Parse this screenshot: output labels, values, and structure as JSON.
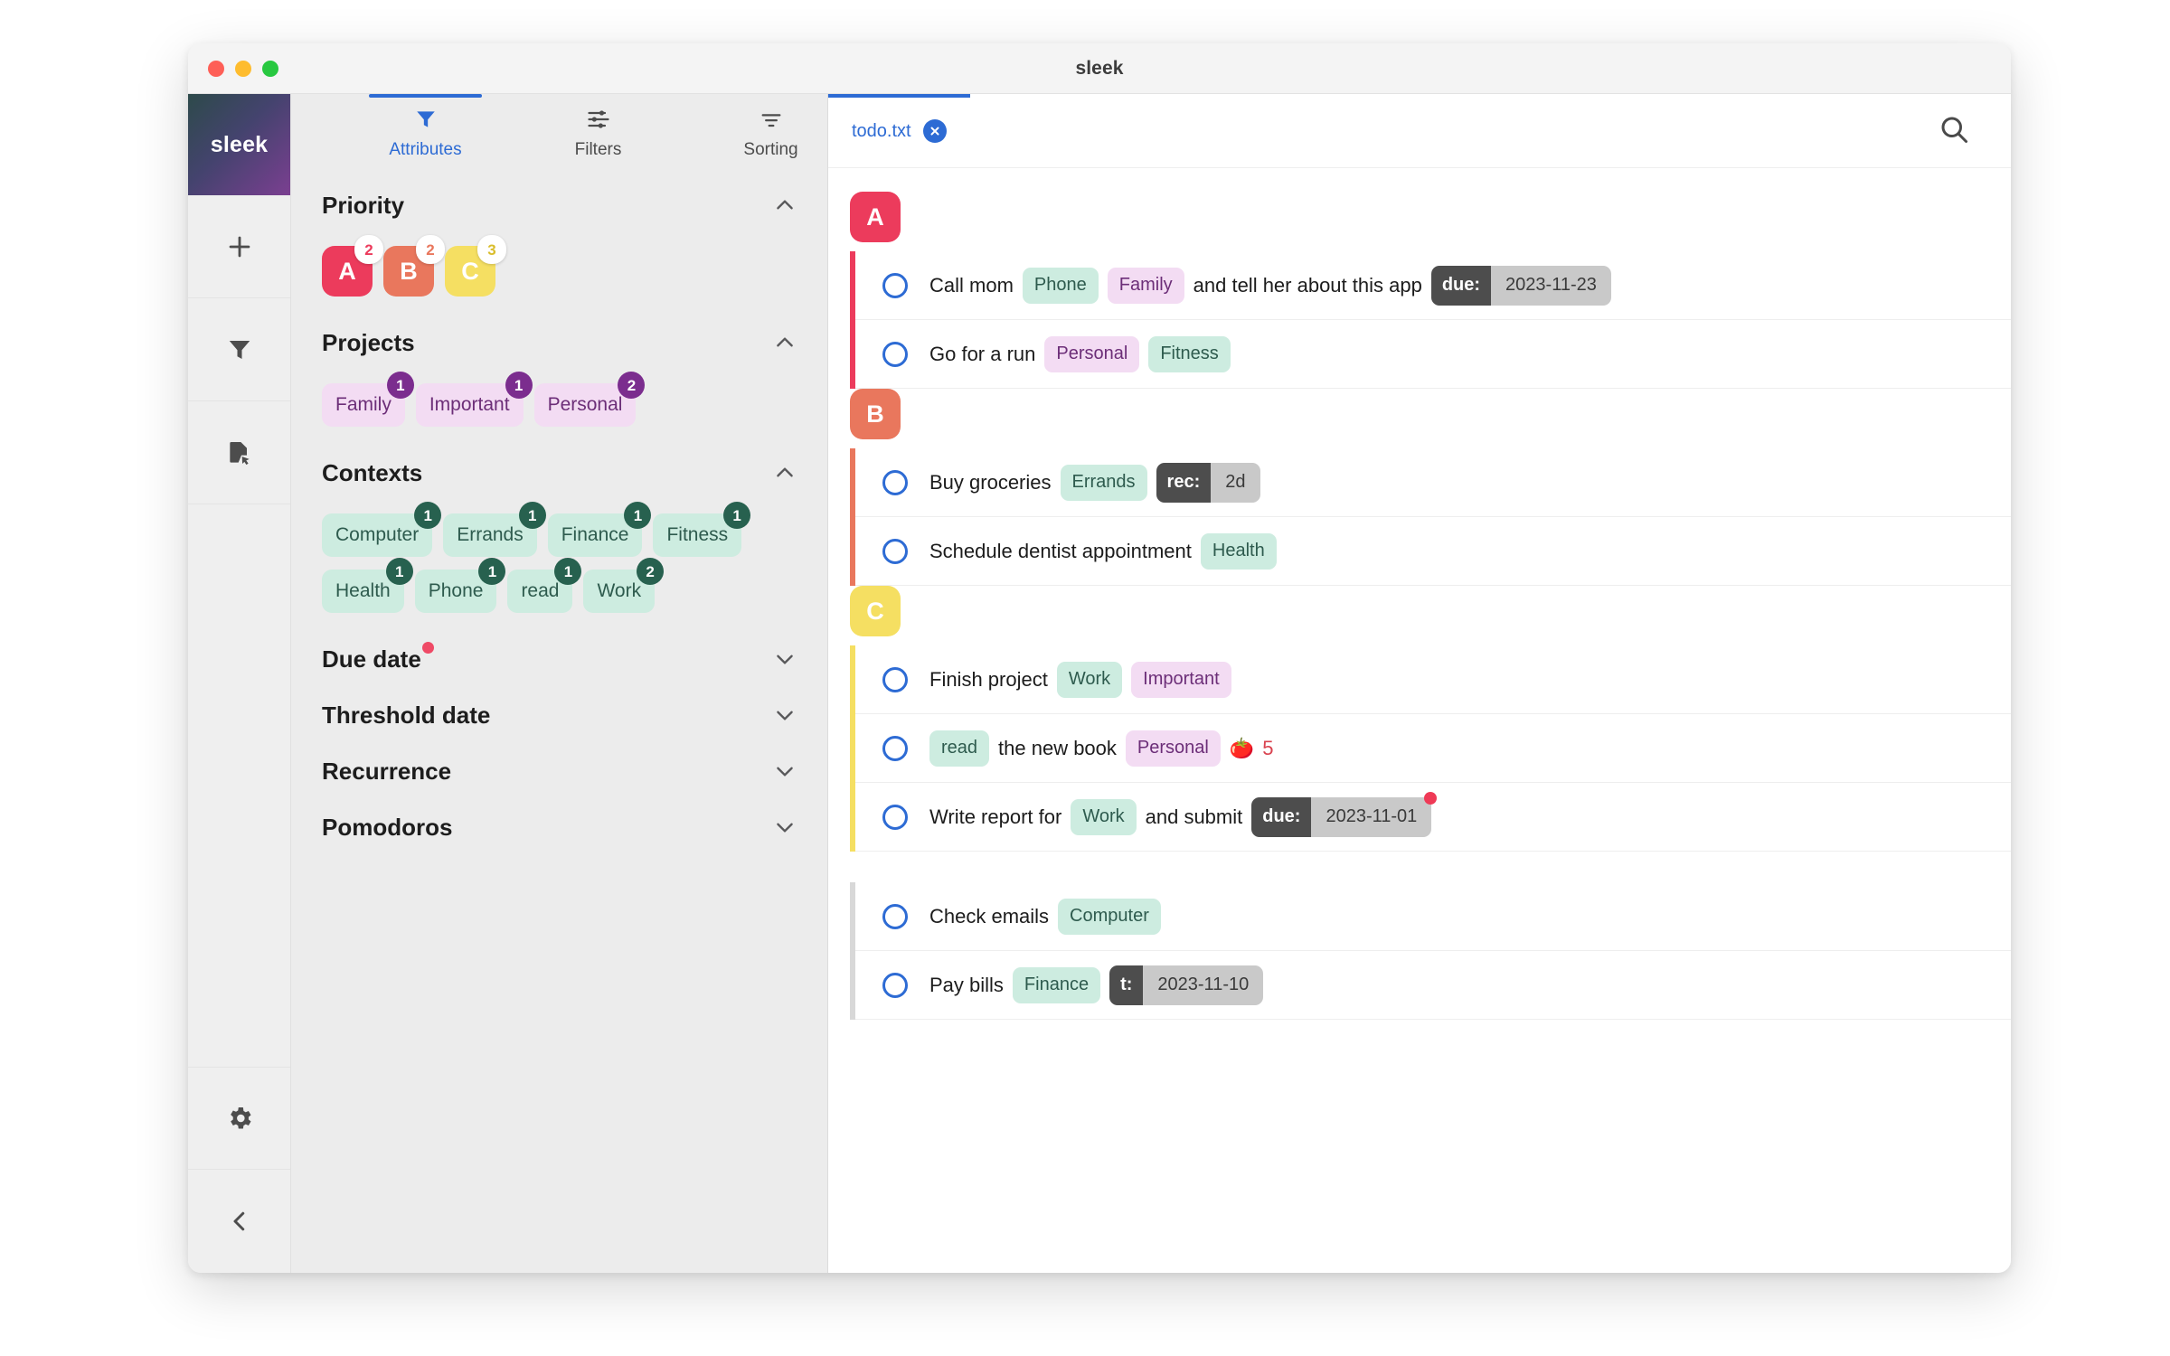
{
  "window": {
    "title": "sleek",
    "traffic_lights": [
      "close",
      "minimize",
      "maximize"
    ]
  },
  "brand": {
    "label": "sleek"
  },
  "rail": {
    "items": [
      {
        "name": "add-todo",
        "icon": "plus-icon"
      },
      {
        "name": "filter",
        "icon": "funnel-icon"
      },
      {
        "name": "open-file",
        "icon": "file-cursor-icon"
      }
    ],
    "bottom_items": [
      {
        "name": "settings",
        "icon": "gear-icon"
      },
      {
        "name": "collapse-drawer",
        "icon": "chevron-left-icon"
      }
    ]
  },
  "drawer": {
    "tabs": [
      {
        "label": "Attributes",
        "icon": "funnel-icon",
        "active": true
      },
      {
        "label": "Filters",
        "icon": "sliders-icon",
        "active": false
      },
      {
        "label": "Sorting",
        "icon": "sort-icon",
        "active": false
      }
    ],
    "sections": [
      {
        "title": "Priority",
        "expanded": true,
        "has_dot": false,
        "chip_class": "prio",
        "chips": [
          {
            "label": "A",
            "count": "2",
            "variant": "prio-a"
          },
          {
            "label": "B",
            "count": "2",
            "variant": "prio-b"
          },
          {
            "label": "C",
            "count": "3",
            "variant": "prio-c"
          }
        ]
      },
      {
        "title": "Projects",
        "expanded": true,
        "has_dot": false,
        "chip_class": "project",
        "chips": [
          {
            "label": "Family",
            "count": "1"
          },
          {
            "label": "Important",
            "count": "1"
          },
          {
            "label": "Personal",
            "count": "2"
          }
        ]
      },
      {
        "title": "Contexts",
        "expanded": true,
        "has_dot": false,
        "chip_class": "context",
        "chips": [
          {
            "label": "Computer",
            "count": "1"
          },
          {
            "label": "Errands",
            "count": "1"
          },
          {
            "label": "Finance",
            "count": "1"
          },
          {
            "label": "Fitness",
            "count": "1"
          },
          {
            "label": "Health",
            "count": "1"
          },
          {
            "label": "Phone",
            "count": "1"
          },
          {
            "label": "read",
            "count": "1"
          },
          {
            "label": "Work",
            "count": "2"
          }
        ]
      },
      {
        "title": "Due date",
        "expanded": false,
        "has_dot": true,
        "chips": []
      },
      {
        "title": "Threshold date",
        "expanded": false,
        "has_dot": false,
        "chips": []
      },
      {
        "title": "Recurrence",
        "expanded": false,
        "has_dot": false,
        "chips": []
      },
      {
        "title": "Pomodoros",
        "expanded": false,
        "has_dot": false,
        "chips": []
      }
    ]
  },
  "main": {
    "file_tabs": [
      {
        "label": "todo.txt",
        "active": true,
        "closable": true
      }
    ],
    "search_icon": "search-icon",
    "groups": [
      {
        "priority": "A",
        "variant": "a",
        "rows": [
          {
            "tokens": [
              {
                "type": "text",
                "value": "Call mom"
              },
              {
                "type": "context",
                "value": "Phone"
              },
              {
                "type": "project",
                "value": "Family"
              },
              {
                "type": "text",
                "value": "and tell her about this app"
              },
              {
                "type": "kv",
                "key": "due:",
                "value": "2023-11-23",
                "dot": false
              }
            ]
          },
          {
            "tokens": [
              {
                "type": "text",
                "value": "Go for a run"
              },
              {
                "type": "project",
                "value": "Personal"
              },
              {
                "type": "context",
                "value": "Fitness"
              }
            ]
          }
        ]
      },
      {
        "priority": "B",
        "variant": "b",
        "rows": [
          {
            "tokens": [
              {
                "type": "text",
                "value": "Buy groceries"
              },
              {
                "type": "context",
                "value": "Errands"
              },
              {
                "type": "kv",
                "key": "rec:",
                "value": "2d",
                "dot": false
              }
            ]
          },
          {
            "tokens": [
              {
                "type": "text",
                "value": "Schedule dentist appointment"
              },
              {
                "type": "context",
                "value": "Health"
              }
            ]
          }
        ]
      },
      {
        "priority": "C",
        "variant": "c",
        "rows": [
          {
            "tokens": [
              {
                "type": "text",
                "value": "Finish project"
              },
              {
                "type": "context",
                "value": "Work"
              },
              {
                "type": "project",
                "value": "Important"
              }
            ]
          },
          {
            "tokens": [
              {
                "type": "context",
                "value": "read"
              },
              {
                "type": "text",
                "value": "the new book"
              },
              {
                "type": "project",
                "value": "Personal"
              },
              {
                "type": "pomodoro",
                "value": "5"
              }
            ]
          },
          {
            "tokens": [
              {
                "type": "text",
                "value": "Write report for"
              },
              {
                "type": "context",
                "value": "Work"
              },
              {
                "type": "text",
                "value": "and submit"
              },
              {
                "type": "kv",
                "key": "due:",
                "value": "2023-11-01",
                "dot": true
              }
            ]
          }
        ]
      },
      {
        "priority": "",
        "variant": "none",
        "rows": [
          {
            "tokens": [
              {
                "type": "text",
                "value": "Check emails"
              },
              {
                "type": "context",
                "value": "Computer"
              }
            ]
          },
          {
            "tokens": [
              {
                "type": "text",
                "value": "Pay bills"
              },
              {
                "type": "context",
                "value": "Finance"
              },
              {
                "type": "kv",
                "key": "t:",
                "value": "2023-11-10",
                "dot": false
              }
            ]
          }
        ]
      }
    ]
  },
  "colors": {
    "accent": "#2d6bd4",
    "priority_a": "#ec3b5c",
    "priority_b": "#e9775d",
    "priority_c": "#f5df62",
    "context_bg": "#cdece0",
    "project_bg": "#f3dcf3",
    "alert_dot": "#ef4a66"
  }
}
